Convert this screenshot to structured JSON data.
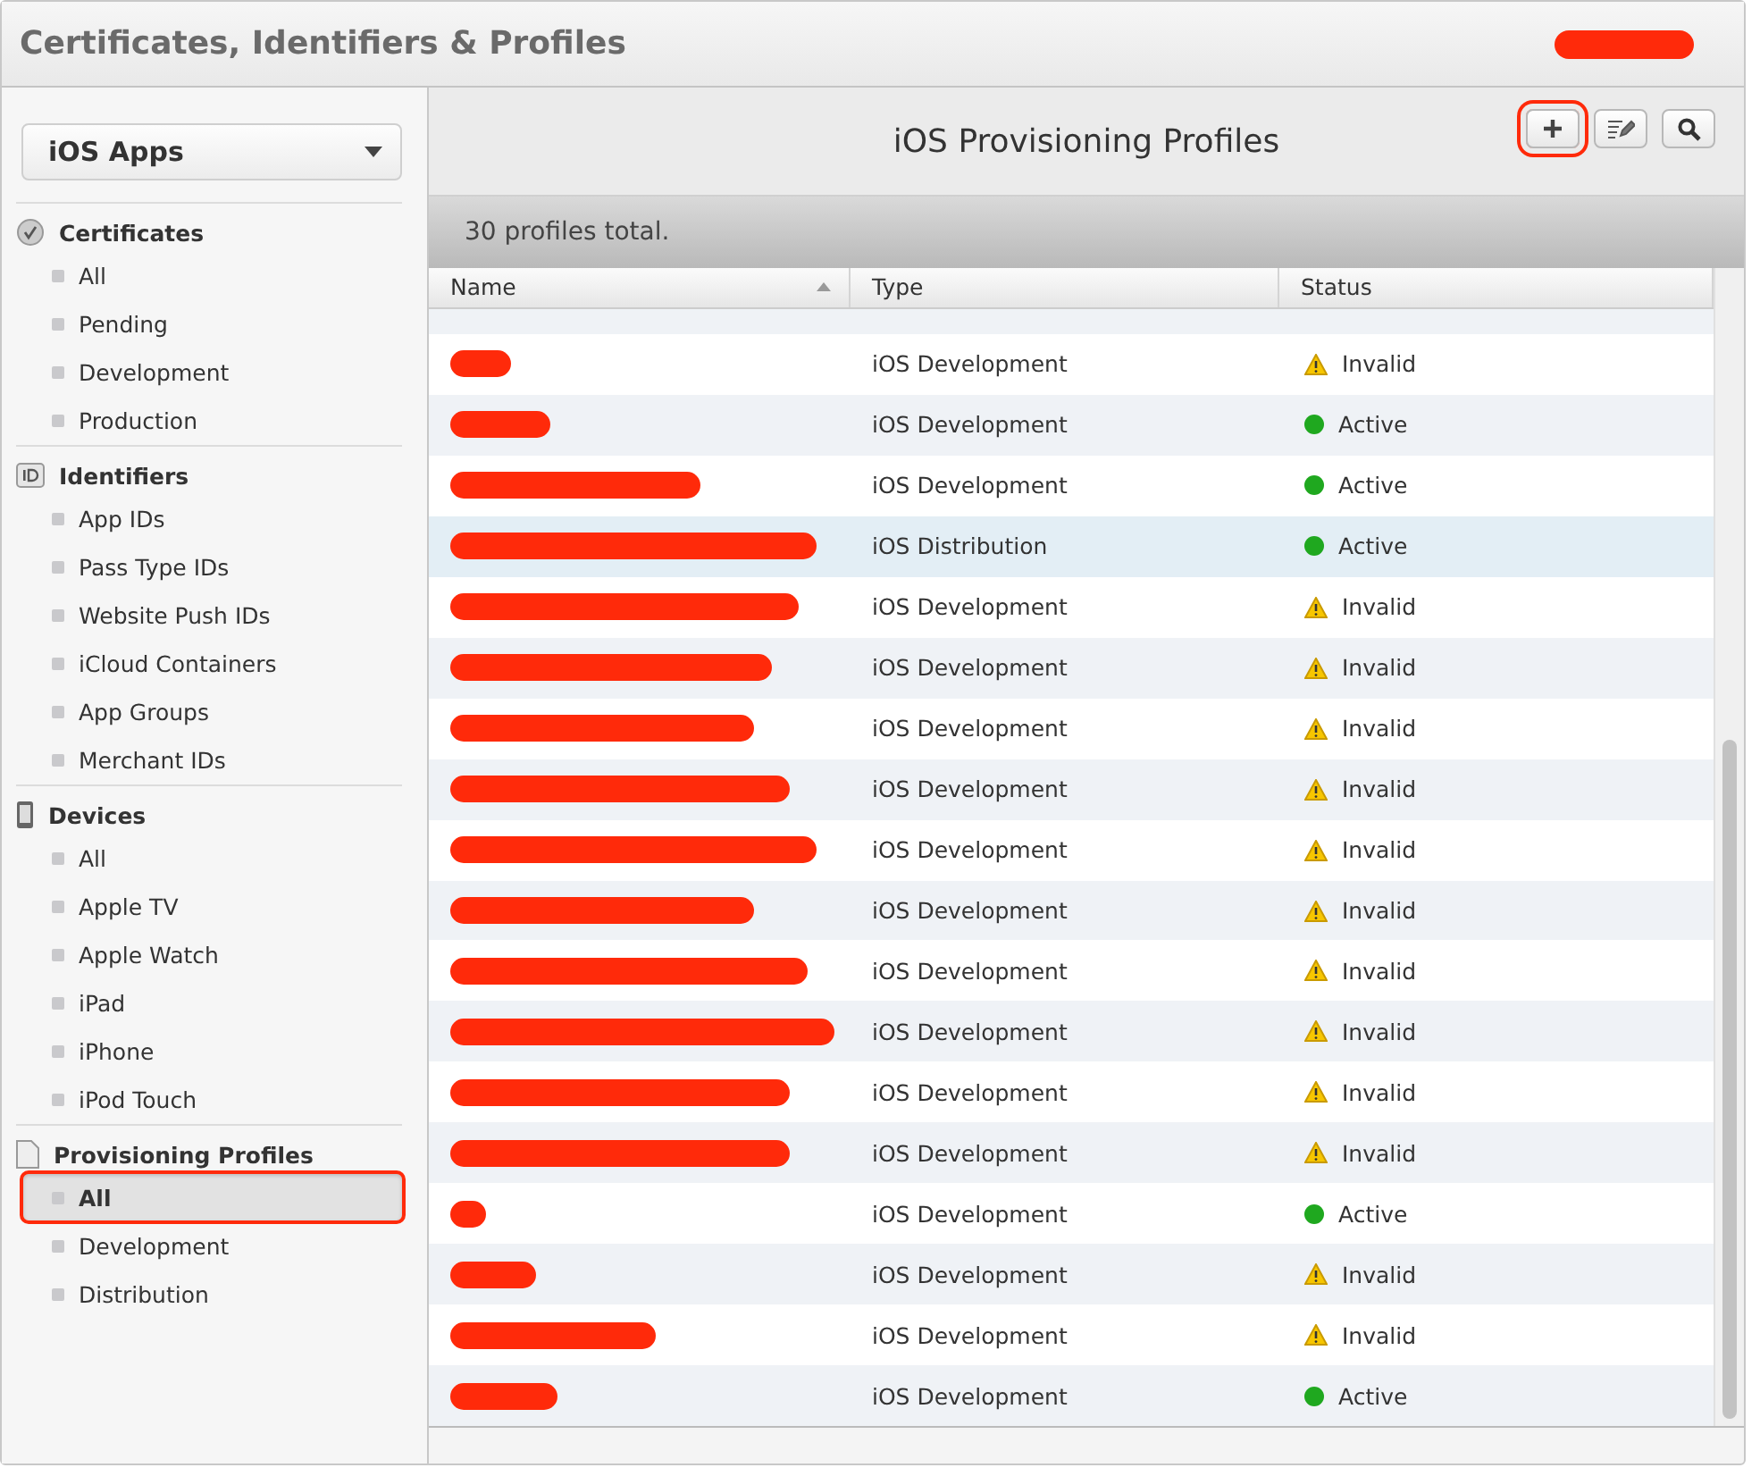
{
  "header": {
    "title": "Certificates, Identifiers & Profiles",
    "account_redacted": true
  },
  "sidebar": {
    "platform": "iOS Apps",
    "sections": [
      {
        "title": "Certificates",
        "kind": "certificate",
        "items": [
          {
            "label": "All",
            "selected": false
          },
          {
            "label": "Pending",
            "selected": false
          },
          {
            "label": "Development",
            "selected": false
          },
          {
            "label": "Production",
            "selected": false
          }
        ]
      },
      {
        "title": "Identifiers",
        "kind": "id",
        "items": [
          {
            "label": "App IDs",
            "selected": false
          },
          {
            "label": "Pass Type IDs",
            "selected": false
          },
          {
            "label": "Website Push IDs",
            "selected": false
          },
          {
            "label": "iCloud Containers",
            "selected": false
          },
          {
            "label": "App Groups",
            "selected": false
          },
          {
            "label": "Merchant IDs",
            "selected": false
          }
        ]
      },
      {
        "title": "Devices",
        "kind": "device",
        "items": [
          {
            "label": "All",
            "selected": false
          },
          {
            "label": "Apple TV",
            "selected": false
          },
          {
            "label": "Apple Watch",
            "selected": false
          },
          {
            "label": "iPad",
            "selected": false
          },
          {
            "label": "iPhone",
            "selected": false
          },
          {
            "label": "iPod Touch",
            "selected": false
          }
        ]
      },
      {
        "title": "Provisioning Profiles",
        "kind": "profile",
        "items": [
          {
            "label": "All",
            "selected": true,
            "highlighted": true
          },
          {
            "label": "Development",
            "selected": false
          },
          {
            "label": "Distribution",
            "selected": false
          }
        ]
      }
    ]
  },
  "main": {
    "title": "iOS Provisioning Profiles",
    "toolbar": [
      {
        "kind": "add",
        "highlighted": true
      },
      {
        "kind": "edit",
        "highlighted": false
      },
      {
        "kind": "search",
        "highlighted": false
      }
    ],
    "summary": "30 profiles total.",
    "table": {
      "columns": [
        "Name",
        "Type",
        "Status"
      ],
      "rows": [
        {
          "type": "iOS Development",
          "status": "Invalid",
          "kind": "invalid",
          "selected": false
        },
        {
          "type": "iOS Development",
          "status": "Active",
          "kind": "active",
          "selected": false
        },
        {
          "type": "iOS Development",
          "status": "Active",
          "kind": "active",
          "selected": false
        },
        {
          "type": "iOS Distribution",
          "status": "Active",
          "kind": "active",
          "selected": true
        },
        {
          "type": "iOS Development",
          "status": "Invalid",
          "kind": "invalid",
          "selected": false
        },
        {
          "type": "iOS Development",
          "status": "Invalid",
          "kind": "invalid",
          "selected": false
        },
        {
          "type": "iOS Development",
          "status": "Invalid",
          "kind": "invalid",
          "selected": false
        },
        {
          "type": "iOS Development",
          "status": "Invalid",
          "kind": "invalid",
          "selected": false
        },
        {
          "type": "iOS Development",
          "status": "Invalid",
          "kind": "invalid",
          "selected": false
        },
        {
          "type": "iOS Development",
          "status": "Invalid",
          "kind": "invalid",
          "selected": false
        },
        {
          "type": "iOS Development",
          "status": "Invalid",
          "kind": "invalid",
          "selected": false
        },
        {
          "type": "iOS Development",
          "status": "Invalid",
          "kind": "invalid",
          "selected": false
        },
        {
          "type": "iOS Development",
          "status": "Invalid",
          "kind": "invalid",
          "selected": false
        },
        {
          "type": "iOS Development",
          "status": "Invalid",
          "kind": "invalid",
          "selected": false
        },
        {
          "type": "iOS Development",
          "status": "Active",
          "kind": "active",
          "selected": false
        },
        {
          "type": "iOS Development",
          "status": "Invalid",
          "kind": "invalid",
          "selected": false
        },
        {
          "type": "iOS Development",
          "status": "Invalid",
          "kind": "invalid",
          "selected": false
        },
        {
          "type": "iOS Development",
          "status": "Active",
          "kind": "active",
          "selected": false
        }
      ]
    }
  }
}
